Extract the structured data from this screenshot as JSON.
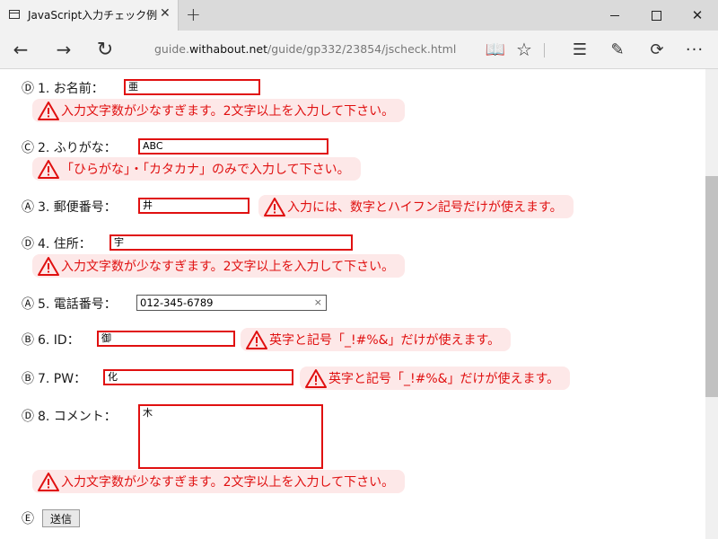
{
  "tab": {
    "title": "JavaScript入力チェック例",
    "close": "✕",
    "new": "+"
  },
  "window": {
    "close": "✕"
  },
  "nav": {
    "back": "←",
    "forward": "→",
    "refresh": "↻",
    "url_prefix": "guide.",
    "url_domain": "withabout.net",
    "url_path": "/guide/gp332/23854/jscheck.html",
    "reading": "📖",
    "favorite": "☆",
    "hub": "☰",
    "note": "✎",
    "share": "⟳",
    "more": "···"
  },
  "form": {
    "rows": [
      {
        "mark": "Ⓓ",
        "label": "1. お名前：",
        "value": "亜",
        "error": "入力文字数が少なすぎます。2文字以上を入力して下さい。"
      },
      {
        "mark": "Ⓒ",
        "label": "2. ふりがな：",
        "value": "ABC",
        "error": "「ひらがな」・「カタカナ」のみで入力して下さい。"
      },
      {
        "mark": "Ⓐ",
        "label": "3. 郵便番号：",
        "value": "井",
        "error": "入力には、数字とハイフン記号だけが使えます。"
      },
      {
        "mark": "Ⓓ",
        "label": "4. 住所：",
        "value": "宇",
        "error": "入力文字数が少なすぎます。2文字以上を入力して下さい。"
      },
      {
        "mark": "Ⓐ",
        "label": "5. 電話番号：",
        "value": "012-345-6789",
        "clear": "×"
      },
      {
        "mark": "Ⓑ",
        "label": "6. ID：",
        "value": "御",
        "error": "英字と記号「_!#%&」だけが使えます。"
      },
      {
        "mark": "Ⓑ",
        "label": "7. PW：",
        "value": "化",
        "error": "英字と記号「_!#%&」だけが使えます。"
      },
      {
        "mark": "Ⓓ",
        "label": "8. コメント：",
        "value": "木",
        "error": "入力文字数が少なすぎます。2文字以上を入力して下さい。"
      }
    ],
    "submit_mark": "Ⓔ",
    "submit_label": "送信"
  },
  "colors": {
    "error": "#e01010",
    "error_bg": "#fde8e8"
  }
}
